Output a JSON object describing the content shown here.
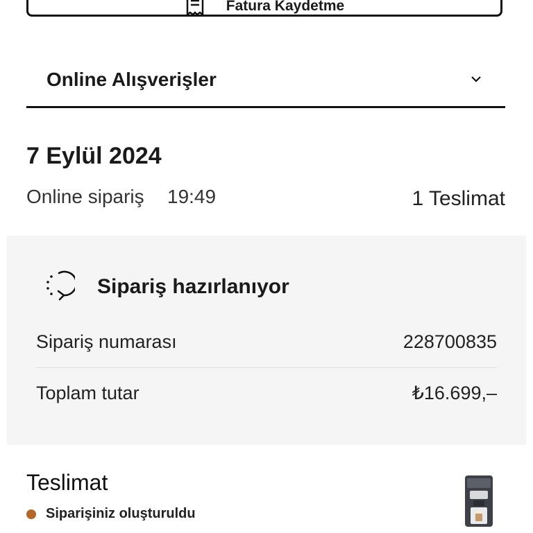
{
  "top_action": {
    "label": "Fatura Kaydetme",
    "icon": "receipt-icon"
  },
  "accordion": {
    "title": "Online Alışverişler",
    "icon": "chevron-down-icon"
  },
  "order": {
    "date": "7 Eylül 2024",
    "type": "Online sipariş",
    "time": "19:49",
    "deliveries": "1 Teslimat"
  },
  "status_card": {
    "status_icon": "loading-arrow-icon",
    "status_title": "Sipariş hazırlanıyor",
    "order_number_label": "Sipariş numarası",
    "order_number_value": "228700835",
    "total_label": "Toplam tutar",
    "total_value": "₺16.699,–"
  },
  "delivery": {
    "title": "Teslimat",
    "status_text": "Siparişiniz oluşturuldu",
    "status_color": "#b3672a",
    "product_image": "coffee-machine-image"
  }
}
